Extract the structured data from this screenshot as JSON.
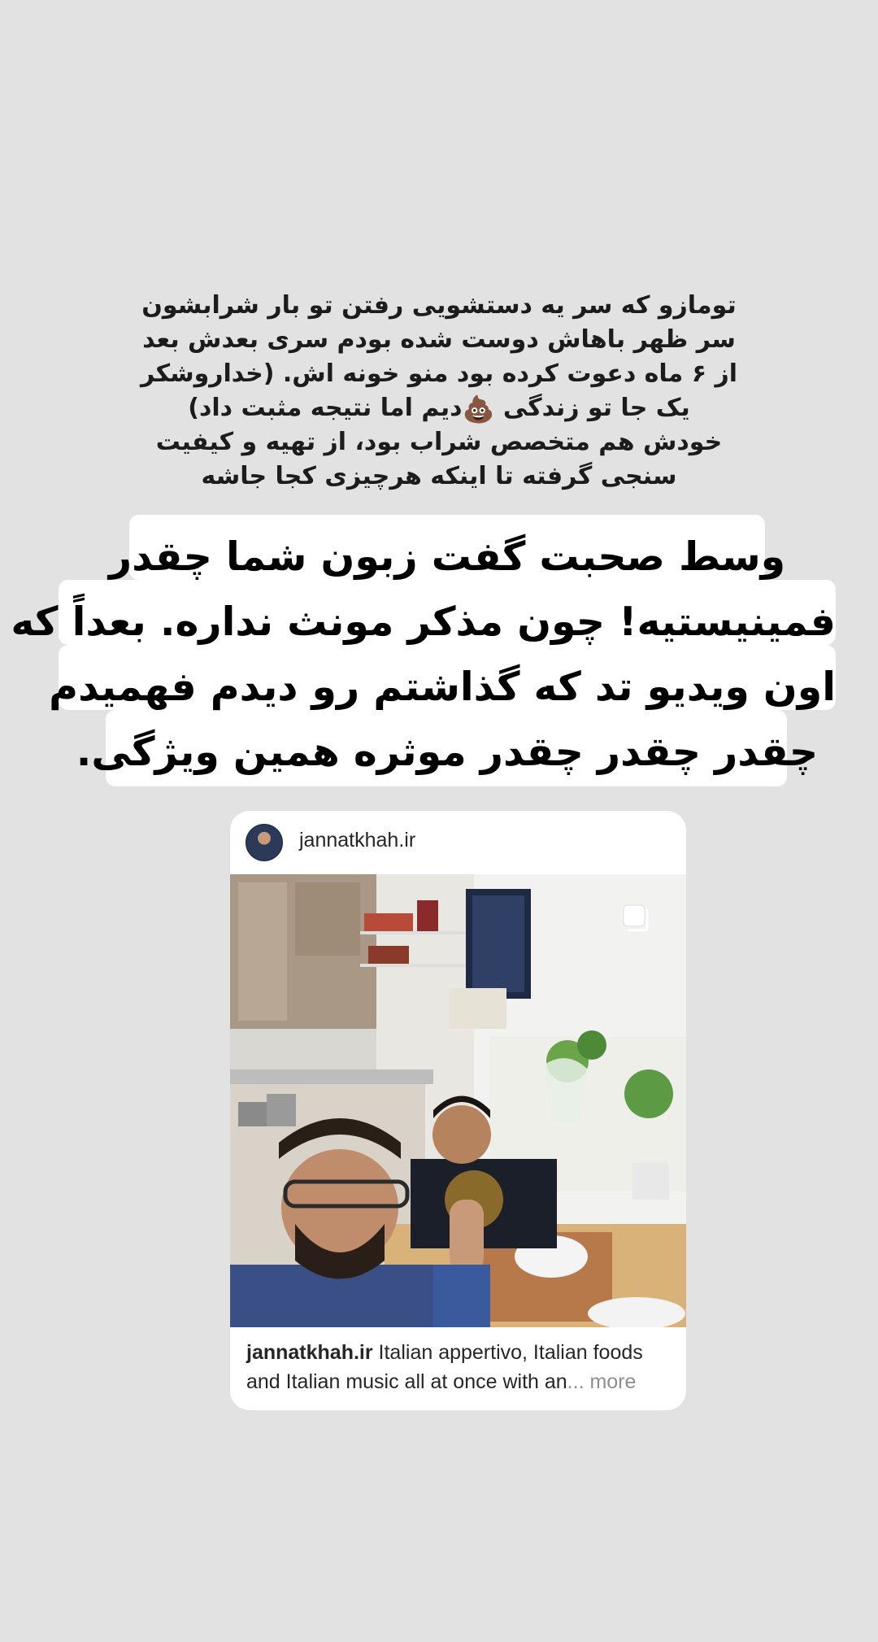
{
  "story": {
    "caption_lines": [
      "تومازو که سر یه دستشویی رفتن تو بار شرابشون",
      "سر ظهر باهاش دوست شده بودم سری بعدش بعد",
      "از ۶ ماه دعوت کرده بود منو خونه اش. (خداروشکر",
      "یک جا تو زندگی",
      "دیم اما نتیجه مثبت داد)",
      "خودش هم متخصص شراب بود، از تهیه و کیفیت",
      "سنجی گرفته تا اینکه هرچیزی کجا جاشه"
    ],
    "emoji": "💩",
    "highlight_lines": [
      "وسط صحبت گفت زبون شما چقدر",
      "فمینیستیه! چون مذکر مونث نداره. بعداً که",
      "اون ویدیو تد که گذاشتم رو دیدم فهمیدم",
      "چقدر چقدر چقدر موثره همین ویژگی."
    ]
  },
  "post": {
    "username": "jannatkhah.ir",
    "caption_user": "jannatkhah.ir",
    "caption_text": " Italian appertivo, Italian foods and Italian music all at once with an",
    "caption_more": "... more",
    "carousel_icon": "multiple-photos-icon"
  },
  "colors": {
    "background": "#e2e2e2",
    "card": "#ffffff",
    "text": "#262626",
    "muted": "#8e8e8e"
  }
}
